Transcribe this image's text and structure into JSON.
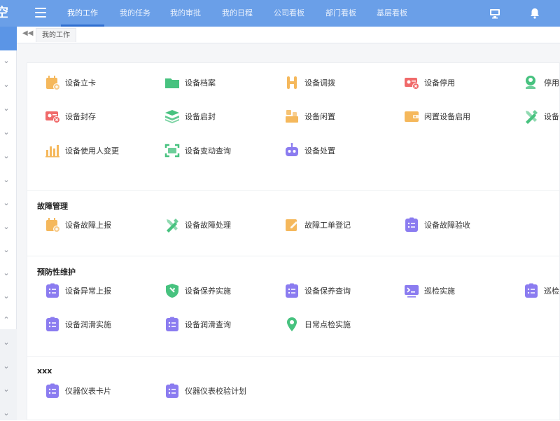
{
  "app": {
    "logo_char": "空"
  },
  "nav": {
    "tabs": [
      {
        "label": "我的工作",
        "active": true
      },
      {
        "label": "我的任务",
        "active": false
      },
      {
        "label": "我的审批",
        "active": false
      },
      {
        "label": "我的日程",
        "active": false
      },
      {
        "label": "公司看板",
        "active": false
      },
      {
        "label": "部门看板",
        "active": false
      },
      {
        "label": "基层看板",
        "active": false
      }
    ],
    "monitor_icon": "monitor-icon",
    "bell_icon": "bell-icon"
  },
  "breadcrumb": {
    "collapse_icon": "double-chevron-left-icon",
    "current_tab": "我的工作"
  },
  "sections": [
    {
      "title": "",
      "items": [
        {
          "label": "设备立卡",
          "icon": "calendar-add-icon",
          "color": "#f5b85c"
        },
        {
          "label": "设备档案",
          "icon": "folder-icon",
          "color": "#47c27f"
        },
        {
          "label": "设备调拨",
          "icon": "transfer-icon",
          "color": "#f5b85c"
        },
        {
          "label": "设备停用",
          "icon": "id-card-stop-icon",
          "color": "#f06a6a"
        },
        {
          "label": "停用",
          "icon": "user-location-icon",
          "color": "#47c27f"
        },
        {
          "label": "设备封存",
          "icon": "id-card-seal-icon",
          "color": "#f06a6a"
        },
        {
          "label": "设备启封",
          "icon": "layers-icon",
          "color": "#47c27f"
        },
        {
          "label": "设备闲置",
          "icon": "boxes-icon",
          "color": "#f5b85c"
        },
        {
          "label": "闲置设备启用",
          "icon": "wallet-icon",
          "color": "#f5b85c"
        },
        {
          "label": "设备",
          "icon": "tools-icon",
          "color": "#47c27f"
        },
        {
          "label": "设备使用人变更",
          "icon": "bar-chart-icon",
          "color": "#f5b85c"
        },
        {
          "label": "设备变动查询",
          "icon": "scan-icon",
          "color": "#47c27f"
        },
        {
          "label": "设备处置",
          "icon": "robot-icon",
          "color": "#8b7cf0"
        }
      ]
    },
    {
      "title": "故障管理",
      "items": [
        {
          "label": "设备故障上报",
          "icon": "calendar-add-icon",
          "color": "#f5b85c"
        },
        {
          "label": "设备故障处理",
          "icon": "tools-icon",
          "color": "#47c27f"
        },
        {
          "label": "故障工单登记",
          "icon": "edit-doc-icon",
          "color": "#f5b85c"
        },
        {
          "label": "设备故障验收",
          "icon": "clipboard-list-icon",
          "color": "#8b7cf0"
        }
      ]
    },
    {
      "title": "预防性维护",
      "items": [
        {
          "label": "设备异常上报",
          "icon": "clipboard-list-icon",
          "color": "#8b7cf0"
        },
        {
          "label": "设备保养实施",
          "icon": "shield-wrench-icon",
          "color": "#47c27f"
        },
        {
          "label": "设备保养查询",
          "icon": "clipboard-list-icon",
          "color": "#8b7cf0"
        },
        {
          "label": "巡检实施",
          "icon": "terminal-icon",
          "color": "#8b7cf0"
        },
        {
          "label": "巡检",
          "icon": "clipboard-list-icon",
          "color": "#8b7cf0"
        },
        {
          "label": "设备润滑实施",
          "icon": "clipboard-list-icon",
          "color": "#8b7cf0"
        },
        {
          "label": "设备润滑查询",
          "icon": "clipboard-list-icon",
          "color": "#8b7cf0"
        },
        {
          "label": "日常点检实施",
          "icon": "location-wrench-icon",
          "color": "#47c27f"
        }
      ]
    },
    {
      "title": "xxx",
      "items": [
        {
          "label": "仪器仪表卡片",
          "icon": "clipboard-list-icon",
          "color": "#8b7cf0"
        },
        {
          "label": "仪器仪表校验计划",
          "icon": "clipboard-list-icon",
          "color": "#8b7cf0"
        }
      ]
    }
  ]
}
